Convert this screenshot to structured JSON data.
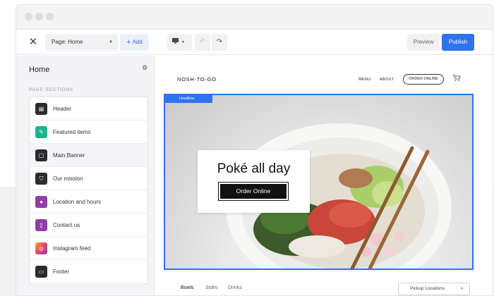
{
  "toolbar": {
    "close_icon": "close-icon",
    "page_select": "Page: Home",
    "add_label": "Add",
    "device_icon": "desktop-icon",
    "undo_icon": "undo-icon",
    "redo_icon": "redo-icon",
    "preview_label": "Preview",
    "publish_label": "Publish"
  },
  "sidebar": {
    "title": "Home",
    "section_label": "PAGE SECTIONS",
    "items": [
      {
        "label": "Header",
        "icon": "header-icon",
        "color": "#2b2b2f"
      },
      {
        "label": "Featured items",
        "icon": "tag-icon",
        "color": "#1fb38f"
      },
      {
        "label": "Main Banner",
        "icon": "banner-icon",
        "color": "#2b2b2f"
      },
      {
        "label": "Our mission",
        "icon": "shield-icon",
        "color": "#2b2b2f"
      },
      {
        "label": "Location and hours",
        "icon": "map-pin-icon",
        "color": "#8e3ea8"
      },
      {
        "label": "Contact us",
        "icon": "contact-card-icon",
        "color": "#8e3ea8"
      },
      {
        "label": "Instagram feed",
        "icon": "instagram-icon",
        "color": "#e3476a"
      },
      {
        "label": "Footer",
        "icon": "footer-icon",
        "color": "#2b2b2f"
      }
    ]
  },
  "site": {
    "brand": "NOSH-TO-GO",
    "nav_menu": "MENU",
    "nav_about": "ABOUT",
    "order_online_pill": "ORDER ONLINE",
    "banner_badge": "Headline",
    "hero_title": "Poké all day",
    "hero_button": "Order Online",
    "tabs": [
      "Bowls",
      "Sides",
      "Drinks"
    ],
    "location_select": "Pickup Locations"
  },
  "colors": {
    "accent": "#2f72ee",
    "publish_bg": "#2f72ee"
  }
}
